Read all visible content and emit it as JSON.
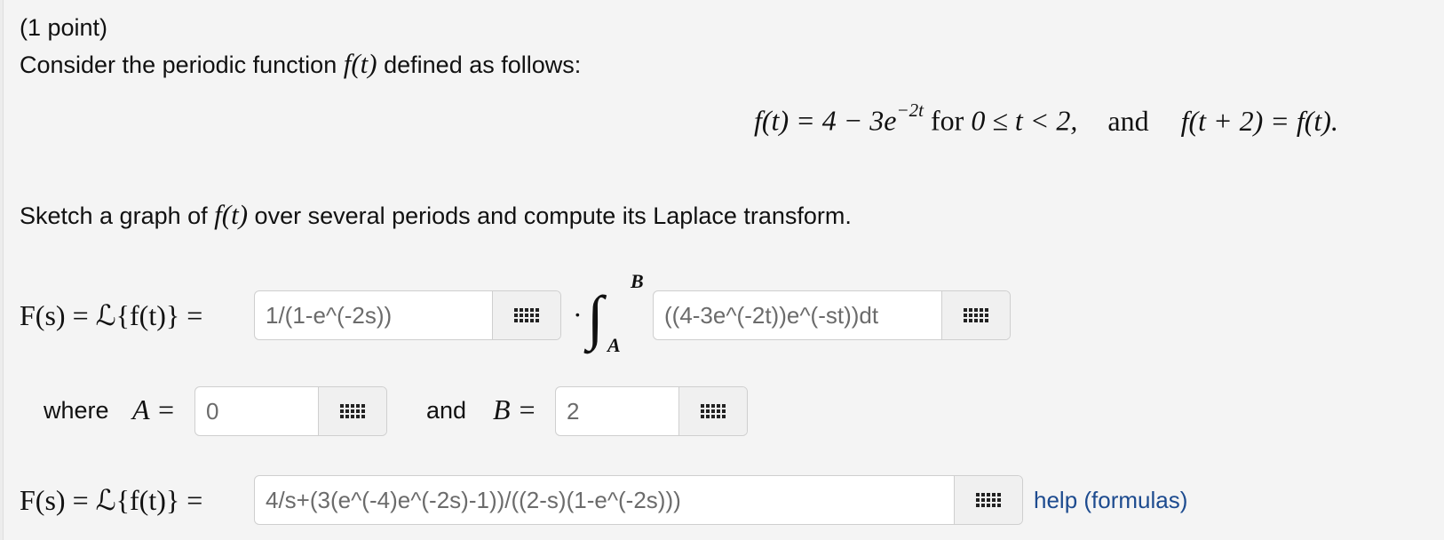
{
  "problem": {
    "points": "(1 point)",
    "intro_before": "Consider the periodic function",
    "intro_after": "defined as follows:",
    "f_of_t": "f(t)",
    "definition": {
      "lhs": "f(t) = 4 − 3e",
      "exp": "−2t",
      "for_word": "for",
      "range": "0 ≤ t < 2,",
      "and_word": "and",
      "periodic": "f(t + 2) = f(t)."
    },
    "sketch_before": "Sketch a graph of",
    "sketch_after": "over several periods and compute its Laplace transform."
  },
  "row1": {
    "lhs": "F(s) = ℒ{f(t)} =",
    "dot": "·",
    "int_upper": "B",
    "int_lower": "A",
    "field1_value": "1/(1-e^(-2s))",
    "field2_value": "((4-3e^(-2t))e^(-st))dt"
  },
  "row2": {
    "where": "where",
    "a_label": "A =",
    "a_value": "0",
    "and": "and",
    "b_label": "B =",
    "b_value": "2"
  },
  "row3": {
    "lhs": "F(s) = ℒ{f(t)} =",
    "value": "4/s+(3(e^(-4)e^(-2s)-1))/((2-s)(1-e^(-2s)))",
    "help": "help (formulas)"
  },
  "icons": {
    "keypad": "grid-icon"
  },
  "colors": {
    "link": "#1d4b8f",
    "panel": "#f4f4f4",
    "input_text": "#6b6b6b"
  }
}
